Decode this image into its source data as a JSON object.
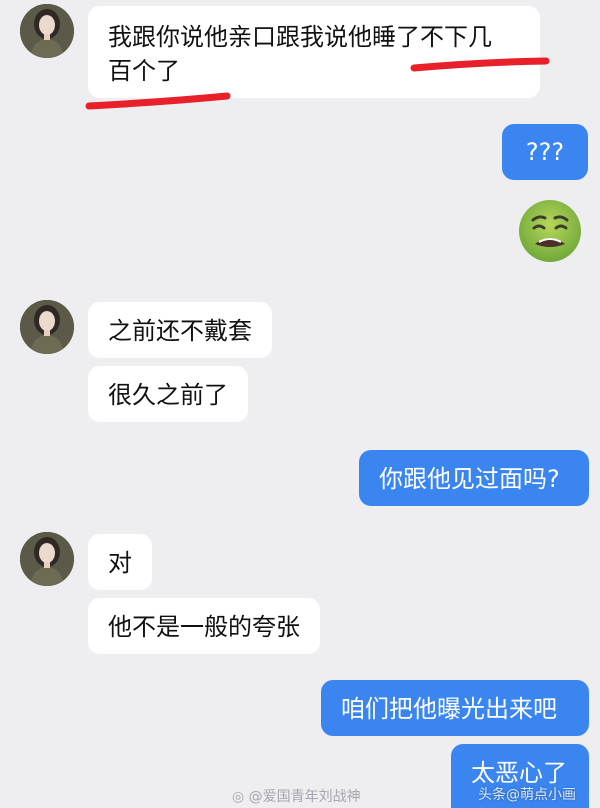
{
  "messages": [
    {
      "id": "m1",
      "side": "in",
      "text_line1": "我跟你说他亲口跟我说他睡了不下几",
      "text_line2": "百个了"
    },
    {
      "id": "m2",
      "side": "out",
      "text": "???"
    },
    {
      "id": "m3",
      "side": "out",
      "emoji": "nauseated-face"
    },
    {
      "id": "m4",
      "side": "in",
      "text": "之前还不戴套"
    },
    {
      "id": "m5",
      "side": "in",
      "text": "很久之前了"
    },
    {
      "id": "m6",
      "side": "out",
      "text": "你跟他见过面吗?"
    },
    {
      "id": "m7",
      "side": "in",
      "text": "对"
    },
    {
      "id": "m8",
      "side": "in",
      "text": "他不是一般的夸张"
    },
    {
      "id": "m9",
      "side": "out",
      "text": "咱们把他曝光出来吧"
    },
    {
      "id": "m10",
      "side": "out",
      "text": "太恶心了"
    }
  ],
  "watermark": {
    "left_text": "@爱国青年刘战神",
    "right_text": "头条@萌点小画"
  },
  "colors": {
    "background": "#eeeef0",
    "incoming_bubble": "#ffffff",
    "outgoing_bubble": "#3a85f0",
    "highlight_underline": "#e8202a"
  }
}
